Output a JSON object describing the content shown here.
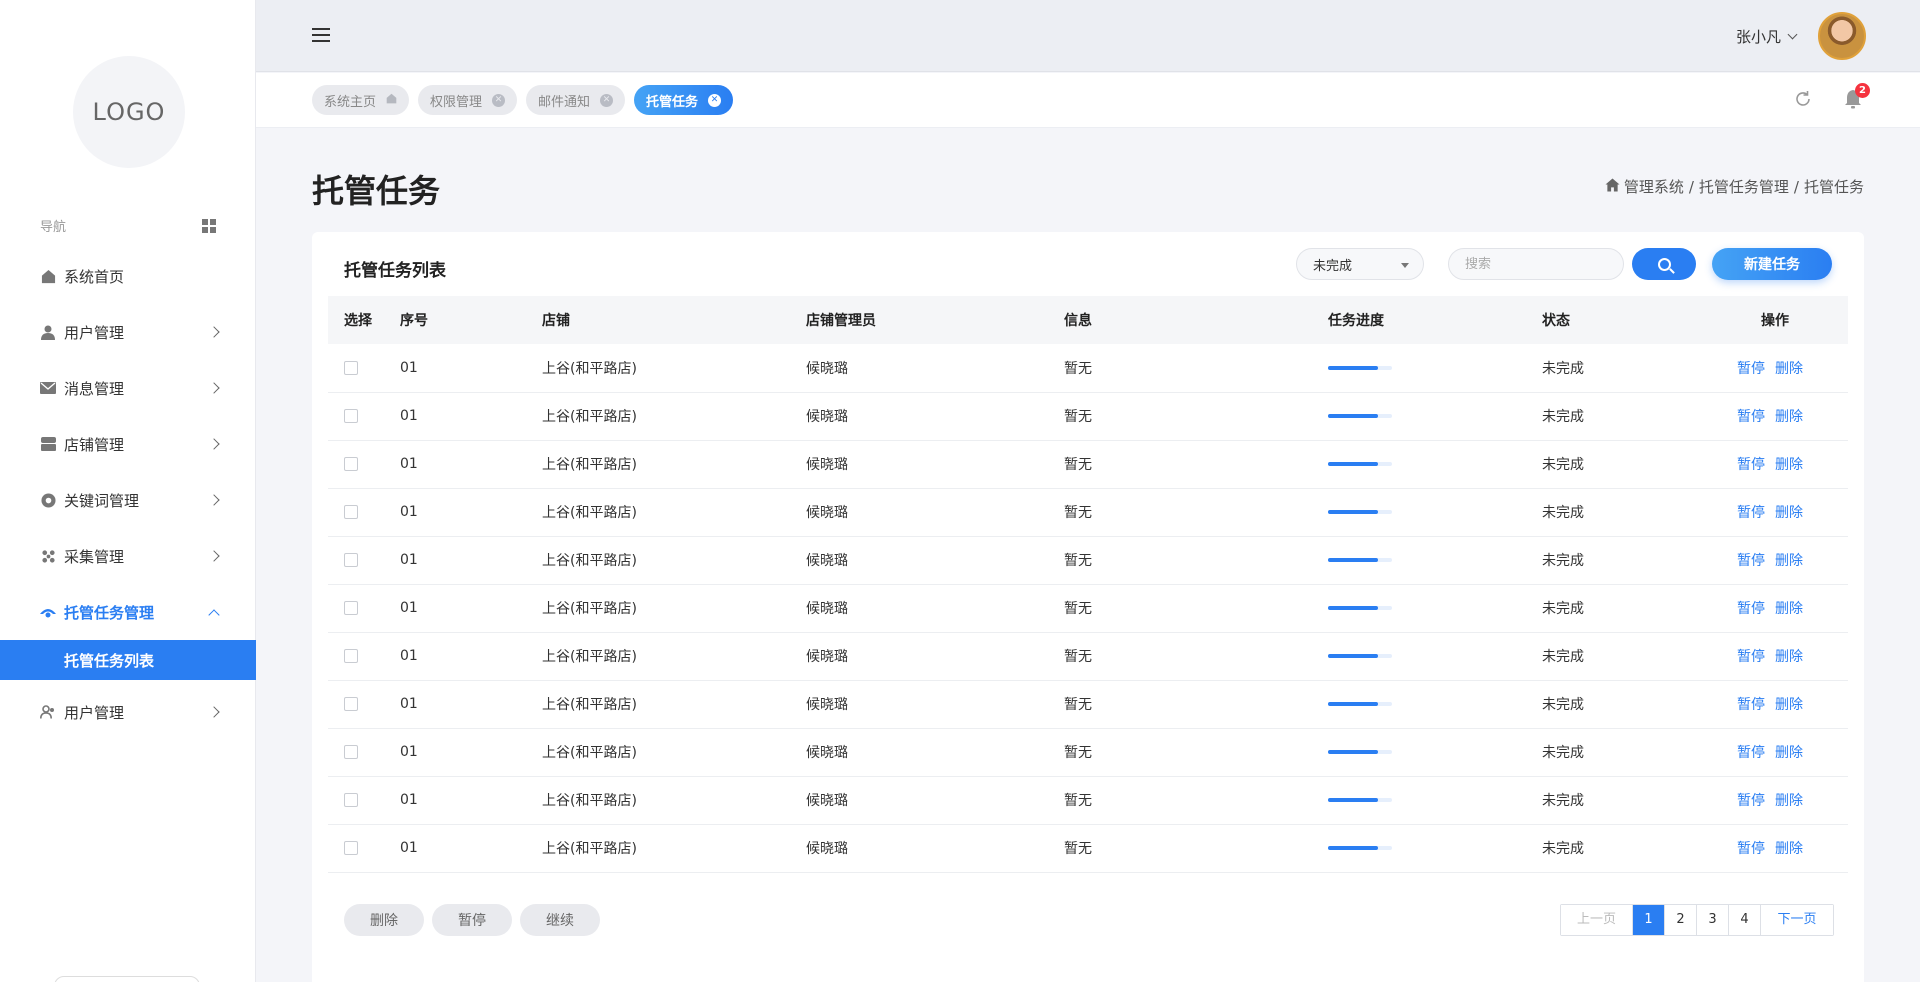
{
  "sidebar": {
    "logo": "LOGO",
    "nav_label": "导航",
    "items": [
      {
        "label": "系统首页",
        "icon": "home-icon"
      },
      {
        "label": "用户管理",
        "icon": "user-icon"
      },
      {
        "label": "消息管理",
        "icon": "mail-icon"
      },
      {
        "label": "店铺管理",
        "icon": "store-icon"
      },
      {
        "label": "关键词管理",
        "icon": "keyword-icon"
      },
      {
        "label": "采集管理",
        "icon": "collect-icon"
      },
      {
        "label": "托管任务管理",
        "icon": "task-icon"
      },
      {
        "label": "用户管理",
        "icon": "users-icon"
      }
    ],
    "sub_item": "托管任务列表"
  },
  "header": {
    "username": "张小凡",
    "notification_count": "2"
  },
  "tabs": [
    {
      "label": "系统主页"
    },
    {
      "label": "权限管理"
    },
    {
      "label": "邮件通知"
    },
    {
      "label": "托管任务"
    }
  ],
  "page": {
    "title": "托管任务",
    "breadcrumb": [
      "管理系统",
      "托管任务管理",
      "托管任务"
    ]
  },
  "card": {
    "title": "托管任务列表",
    "filter_value": "未完成",
    "search_placeholder": "搜索",
    "new_button": "新建任务"
  },
  "table": {
    "headers": [
      "选择",
      "序号",
      "店铺",
      "店铺管理员",
      "信息",
      "任务进度",
      "状态",
      "操作"
    ],
    "rows": [
      {
        "no": "01",
        "store": "上谷(和平路店)",
        "admin": "候晓璐",
        "info": "暂无",
        "progress": 0.78,
        "status": "未完成"
      },
      {
        "no": "01",
        "store": "上谷(和平路店)",
        "admin": "候晓璐",
        "info": "暂无",
        "progress": 0.78,
        "status": "未完成"
      },
      {
        "no": "01",
        "store": "上谷(和平路店)",
        "admin": "候晓璐",
        "info": "暂无",
        "progress": 0.78,
        "status": "未完成"
      },
      {
        "no": "01",
        "store": "上谷(和平路店)",
        "admin": "候晓璐",
        "info": "暂无",
        "progress": 0.78,
        "status": "未完成"
      },
      {
        "no": "01",
        "store": "上谷(和平路店)",
        "admin": "候晓璐",
        "info": "暂无",
        "progress": 0.78,
        "status": "未完成"
      },
      {
        "no": "01",
        "store": "上谷(和平路店)",
        "admin": "候晓璐",
        "info": "暂无",
        "progress": 0.78,
        "status": "未完成"
      },
      {
        "no": "01",
        "store": "上谷(和平路店)",
        "admin": "候晓璐",
        "info": "暂无",
        "progress": 0.78,
        "status": "未完成"
      },
      {
        "no": "01",
        "store": "上谷(和平路店)",
        "admin": "候晓璐",
        "info": "暂无",
        "progress": 0.78,
        "status": "未完成"
      },
      {
        "no": "01",
        "store": "上谷(和平路店)",
        "admin": "候晓璐",
        "info": "暂无",
        "progress": 0.78,
        "status": "未完成"
      },
      {
        "no": "01",
        "store": "上谷(和平路店)",
        "admin": "候晓璐",
        "info": "暂无",
        "progress": 0.78,
        "status": "未完成"
      },
      {
        "no": "01",
        "store": "上谷(和平路店)",
        "admin": "候晓璐",
        "info": "暂无",
        "progress": 0.78,
        "status": "未完成"
      }
    ],
    "action_pause": "暂停",
    "action_delete": "删除"
  },
  "footer": {
    "buttons": [
      "删除",
      "暂停",
      "继续"
    ],
    "pager": {
      "prev": "上一页",
      "pages": [
        "1",
        "2",
        "3",
        "4"
      ],
      "current": "1",
      "next": "下一页"
    }
  },
  "colors": {
    "accent": "#2a7ef2",
    "badge": "#f5333f"
  }
}
